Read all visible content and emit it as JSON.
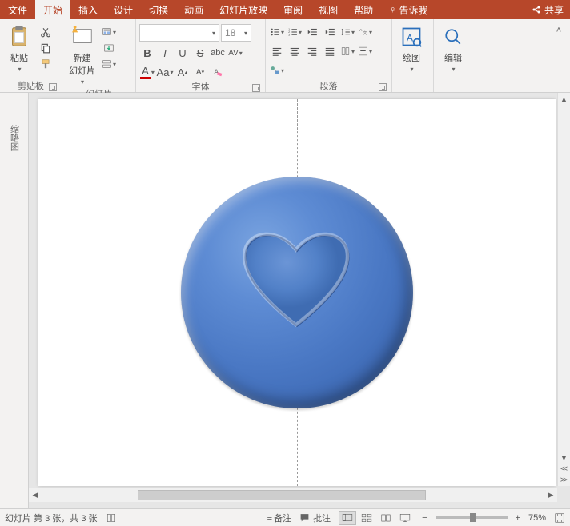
{
  "tabs": {
    "file": "文件",
    "home": "开始",
    "insert": "插入",
    "design": "设计",
    "transitions": "切换",
    "animations": "动画",
    "slideshow": "幻灯片放映",
    "review": "审阅",
    "view": "视图",
    "help": "帮助",
    "tell_me": "告诉我",
    "share": "共享"
  },
  "ribbon": {
    "clipboard": {
      "label": "剪贴板",
      "paste": "粘贴"
    },
    "slides": {
      "label": "幻灯片",
      "new_slide": "新建\n幻灯片"
    },
    "font": {
      "label": "字体",
      "size": "18",
      "placeholder": ""
    },
    "paragraph": {
      "label": "段落"
    },
    "drawing": {
      "label": "绘图"
    },
    "editing": {
      "label": "编辑"
    }
  },
  "thumb_pane": {
    "label": "缩略图"
  },
  "status": {
    "slide_info": "幻灯片 第 3 张，共 3 张",
    "notes": "备注",
    "comments": "批注",
    "zoom": "75%"
  },
  "colors": {
    "accent": "#b7472a",
    "shape": "#4a78c4"
  }
}
